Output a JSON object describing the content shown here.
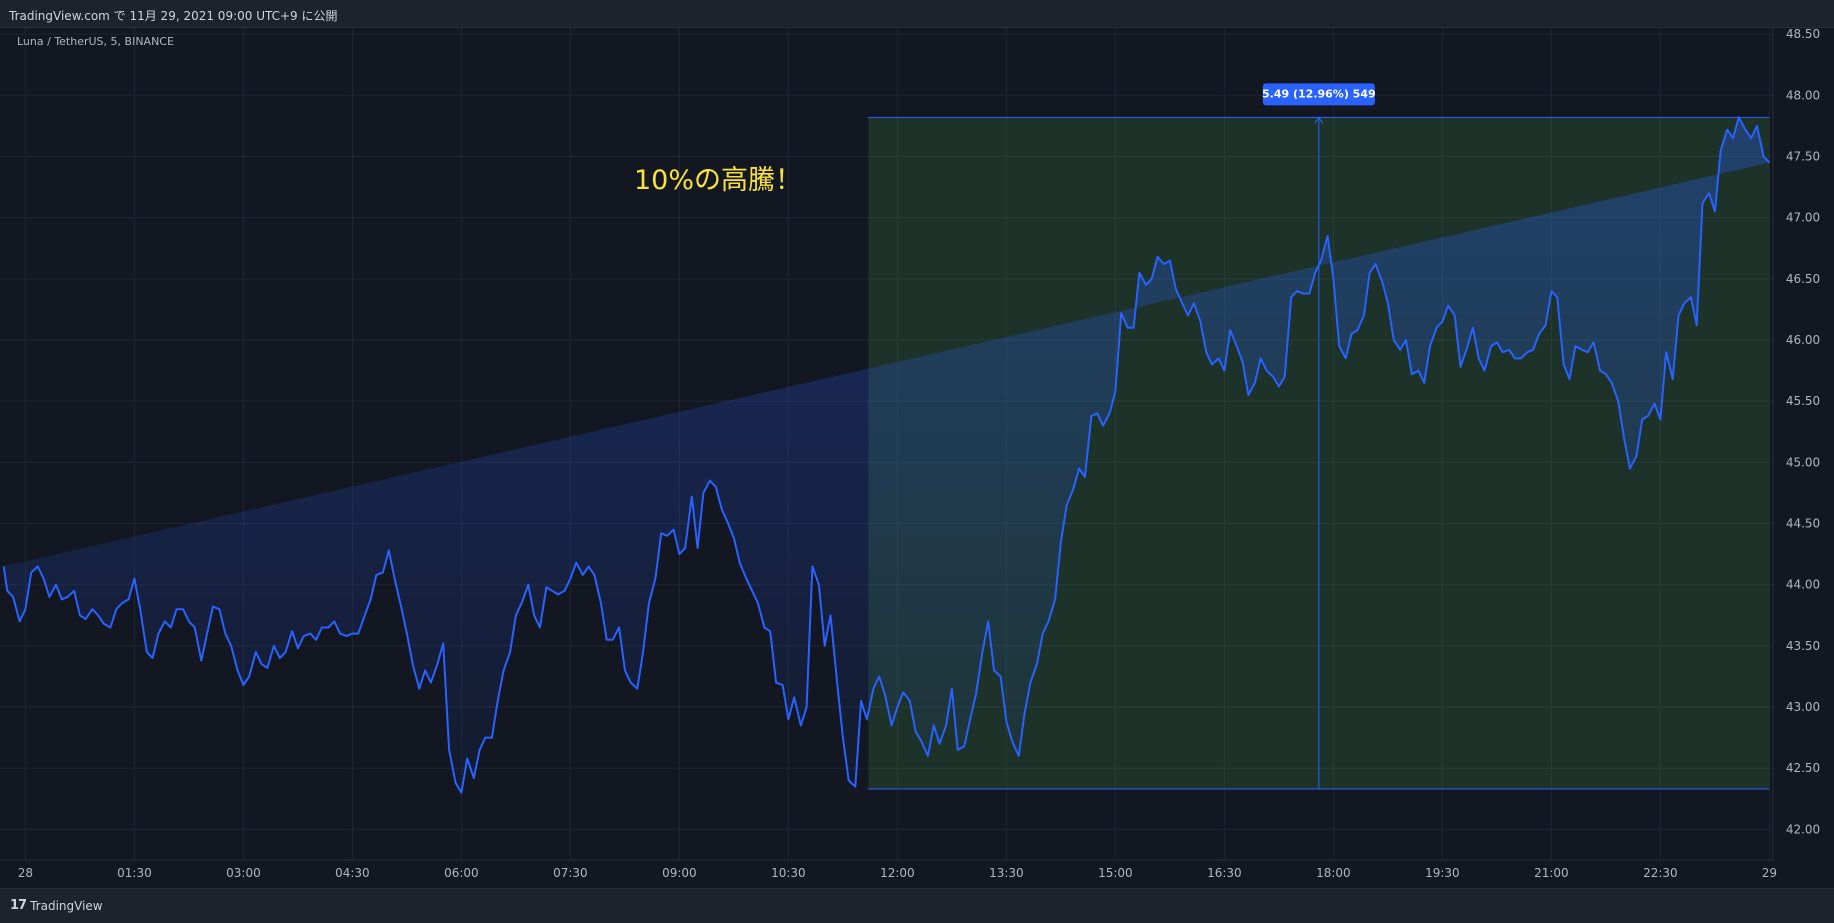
{
  "header": {
    "published": "TradingView.com で 11月 29, 2021 09:00 UTC+9 に公開"
  },
  "footer": {
    "brand_mark": "17",
    "brand": "TradingView"
  },
  "colors": {
    "background": "#131722",
    "line": "#2962ff",
    "range_fill": "rgba(76,175,80,0.18)",
    "annotation": "#f9e23a",
    "label_bg": "#2962ff"
  },
  "chart_data": {
    "type": "area",
    "symbol": "Luna / TetherUS, 5, BINANCE",
    "annotation": "10%の高騰！",
    "range_label": "5.49 (12.96%) 549",
    "x_tick_labels": [
      "28",
      "01:30",
      "03:00",
      "04:30",
      "06:00",
      "07:30",
      "09:00",
      "10:30",
      "12:00",
      "13:30",
      "15:00",
      "16:30",
      "18:00",
      "19:30",
      "21:00",
      "22:30",
      "29"
    ],
    "y_ticks": [
      "42.00",
      "42.50",
      "43.00",
      "43.50",
      "44.00",
      "44.50",
      "45.00",
      "45.50",
      "46.00",
      "46.50",
      "47.00",
      "47.50",
      "48.00",
      "48.50"
    ],
    "ylim": [
      41.75,
      48.55
    ],
    "xlim_hours": [
      -0.35,
      24.05
    ],
    "price_range": {
      "start_hour": 11.6,
      "end_hour": 24.0,
      "low": 42.33,
      "high": 47.82
    },
    "series": [
      {
        "x_hours": [
          -0.3,
          -0.25,
          -0.17,
          -0.08,
          0,
          0.08,
          0.17,
          0.25,
          0.33,
          0.42,
          0.5,
          0.58,
          0.67,
          0.75,
          0.83,
          0.92,
          1,
          1.08,
          1.17,
          1.25,
          1.33,
          1.42,
          1.5,
          1.58,
          1.67,
          1.75,
          1.83,
          1.92,
          2,
          2.08,
          2.17,
          2.25,
          2.33,
          2.42,
          2.5,
          2.58,
          2.67,
          2.75,
          2.83,
          2.92,
          3,
          3.08,
          3.17,
          3.25,
          3.33,
          3.42,
          3.5,
          3.58,
          3.67,
          3.75,
          3.83,
          3.92,
          4,
          4.08,
          4.17,
          4.25,
          4.33,
          4.42,
          4.5,
          4.58,
          4.67,
          4.75,
          4.83,
          4.92,
          5,
          5.08,
          5.17,
          5.25,
          5.33,
          5.42,
          5.5,
          5.58,
          5.67,
          5.75,
          5.83,
          5.92,
          6,
          6.08,
          6.17,
          6.25,
          6.33,
          6.42,
          6.5,
          6.58,
          6.67,
          6.75,
          6.83,
          6.92,
          7,
          7.08,
          7.17,
          7.25,
          7.33,
          7.42,
          7.5,
          7.58,
          7.67,
          7.75,
          7.83,
          7.92,
          8,
          8.08,
          8.17,
          8.25,
          8.33,
          8.42,
          8.5,
          8.58,
          8.67,
          8.75,
          8.83,
          8.92,
          9,
          9.08,
          9.17,
          9.25,
          9.33,
          9.42,
          9.5,
          9.58,
          9.67,
          9.75,
          9.83,
          9.92,
          10,
          10.08,
          10.17,
          10.25,
          10.33,
          10.42,
          10.5,
          10.58,
          10.67,
          10.75,
          10.83,
          10.92,
          11,
          11.08,
          11.17,
          11.25,
          11.33,
          11.42,
          11.5,
          11.58,
          11.67,
          11.75,
          11.83,
          11.92,
          12,
          12.08,
          12.17,
          12.25,
          12.33,
          12.42,
          12.5,
          12.58,
          12.67,
          12.75,
          12.83,
          12.92,
          13,
          13.08,
          13.17,
          13.25,
          13.33,
          13.42,
          13.5,
          13.58,
          13.67,
          13.75,
          13.83,
          13.92,
          14,
          14.08,
          14.17,
          14.25,
          14.33,
          14.42,
          14.5,
          14.58,
          14.67,
          14.75,
          14.83,
          14.92,
          15,
          15.08,
          15.17,
          15.25,
          15.33,
          15.42,
          15.5,
          15.58,
          15.67,
          15.75,
          15.83,
          15.92,
          16,
          16.08,
          16.17,
          16.25,
          16.33,
          16.42,
          16.5,
          16.58,
          16.67,
          16.75,
          16.83,
          16.92,
          17,
          17.08,
          17.17,
          17.25,
          17.33,
          17.42,
          17.5,
          17.58,
          17.67,
          17.75,
          17.83,
          17.92,
          18,
          18.08,
          18.17,
          18.25,
          18.33,
          18.42,
          18.5,
          18.58,
          18.67,
          18.75,
          18.83,
          18.92,
          19,
          19.08,
          19.17,
          19.25,
          19.33,
          19.42,
          19.5,
          19.58,
          19.67,
          19.75,
          19.83,
          19.92,
          20,
          20.08,
          20.17,
          20.25,
          20.33,
          20.42,
          20.5,
          20.58,
          20.67,
          20.75,
          20.83,
          20.92,
          21,
          21.08,
          21.17,
          21.25,
          21.33,
          21.42,
          21.5,
          21.58,
          21.67,
          21.75,
          21.83,
          21.92,
          22,
          22.08,
          22.17,
          22.25,
          22.33,
          22.42,
          22.5,
          22.58,
          22.67,
          22.75,
          22.83,
          22.92,
          23,
          23.08,
          23.17,
          23.25,
          23.33,
          23.42,
          23.5,
          23.58,
          23.67,
          23.75,
          23.83,
          23.92,
          24,
          24.05
        ],
        "values": [
          44.15,
          43.95,
          43.9,
          43.7,
          43.8,
          44.1,
          44.15,
          44.05,
          43.9,
          44.0,
          43.88,
          43.9,
          43.95,
          43.75,
          43.72,
          43.8,
          43.75,
          43.68,
          43.65,
          43.8,
          43.85,
          43.88,
          44.05,
          43.8,
          43.45,
          43.4,
          43.6,
          43.7,
          43.65,
          43.8,
          43.8,
          43.7,
          43.65,
          43.38,
          43.6,
          43.82,
          43.8,
          43.6,
          43.5,
          43.3,
          43.18,
          43.25,
          43.45,
          43.35,
          43.32,
          43.5,
          43.4,
          43.45,
          43.62,
          43.48,
          43.58,
          43.6,
          43.55,
          43.65,
          43.65,
          43.7,
          43.6,
          43.58,
          43.6,
          43.6,
          43.75,
          43.88,
          44.08,
          44.1,
          44.28,
          44.05,
          43.82,
          43.6,
          43.35,
          43.15,
          43.3,
          43.2,
          43.35,
          43.52,
          42.65,
          42.38,
          42.3,
          42.58,
          42.42,
          42.65,
          42.75,
          42.75,
          43.05,
          43.3,
          43.45,
          43.75,
          43.85,
          44.0,
          43.75,
          43.65,
          43.98,
          43.95,
          43.92,
          43.95,
          44.05,
          44.18,
          44.08,
          44.15,
          44.08,
          43.85,
          43.55,
          43.55,
          43.65,
          43.3,
          43.2,
          43.15,
          43.45,
          43.85,
          44.05,
          44.42,
          44.4,
          44.45,
          44.25,
          44.3,
          44.72,
          44.3,
          44.75,
          44.85,
          44.8,
          44.62,
          44.5,
          44.38,
          44.18,
          44.05,
          43.95,
          43.85,
          43.65,
          43.62,
          43.2,
          43.18,
          42.9,
          43.08,
          42.85,
          43.0,
          44.15,
          44.0,
          43.5,
          43.75,
          43.2,
          42.75,
          42.4,
          42.35,
          43.05,
          42.9,
          43.15,
          43.25,
          43.1,
          42.85,
          43.0,
          43.12,
          43.05,
          42.8,
          42.72,
          42.6,
          42.85,
          42.7,
          42.85,
          43.15,
          42.65,
          42.68,
          42.9,
          43.1,
          43.45,
          43.7,
          43.3,
          43.25,
          42.88,
          42.72,
          42.6,
          42.95,
          43.2,
          43.35,
          43.6,
          43.7,
          43.88,
          44.35,
          44.65,
          44.78,
          44.95,
          44.88,
          45.38,
          45.4,
          45.3,
          45.4,
          45.58,
          46.22,
          46.1,
          46.1,
          46.55,
          46.45,
          46.5,
          46.68,
          46.62,
          46.65,
          46.42,
          46.3,
          46.2,
          46.3,
          46.15,
          45.9,
          45.8,
          45.85,
          45.75,
          46.08,
          45.95,
          45.82,
          45.55,
          45.65,
          45.85,
          45.75,
          45.7,
          45.62,
          45.7,
          46.35,
          46.4,
          46.38,
          46.38,
          46.55,
          46.65,
          46.85,
          46.5,
          45.95,
          45.85,
          46.05,
          46.08,
          46.2,
          46.55,
          46.62,
          46.48,
          46.3,
          46.0,
          45.92,
          46.0,
          45.72,
          45.75,
          45.65,
          45.95,
          46.1,
          46.15,
          46.28,
          46.2,
          45.78,
          45.92,
          46.1,
          45.85,
          45.75,
          45.95,
          45.98,
          45.9,
          45.92,
          45.85,
          45.85,
          45.9,
          45.92,
          46.05,
          46.12,
          46.4,
          46.35,
          45.8,
          45.68,
          45.95,
          45.92,
          45.9,
          45.98,
          45.75,
          45.72,
          45.65,
          45.5,
          45.2,
          44.95,
          45.05,
          45.35,
          45.38,
          45.48,
          45.35,
          45.9,
          45.68,
          46.2,
          46.3,
          46.35,
          46.12,
          47.12,
          47.2,
          47.05,
          47.55,
          47.72,
          47.65,
          47.82,
          47.72,
          47.65,
          47.75,
          47.5,
          47.45
        ]
      }
    ]
  }
}
